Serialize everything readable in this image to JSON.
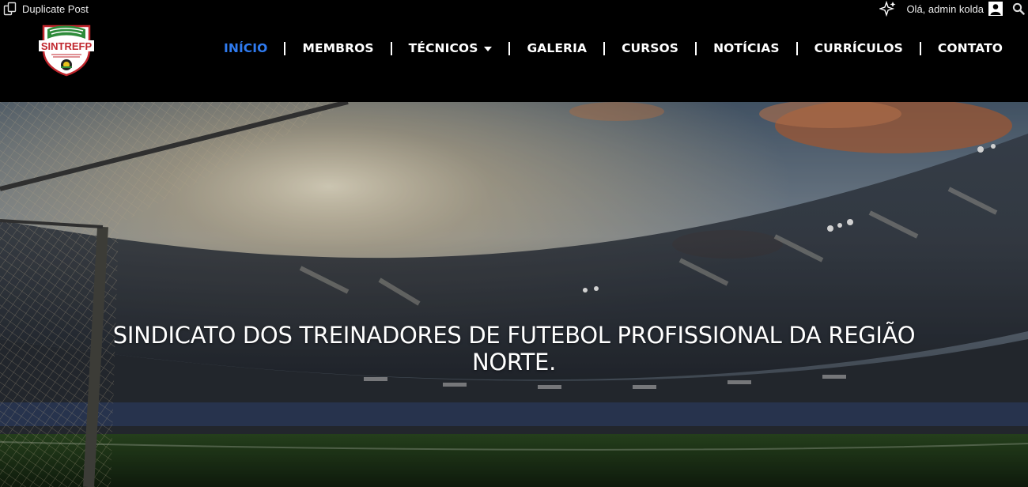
{
  "admin_bar": {
    "duplicate_post_label": "Duplicate Post",
    "greeting": "Olá, admin kolda",
    "icons": [
      "duplicate-icon",
      "sparkle-icon",
      "user-avatar-icon",
      "search-icon"
    ]
  },
  "header": {
    "logo_text": "SINTREFP",
    "nav": [
      {
        "label": "INÍCIO",
        "active": true
      },
      {
        "label": "MEMBROS"
      },
      {
        "label": "TÉCNICOS",
        "has_dropdown": true
      },
      {
        "label": "GALERIA"
      },
      {
        "label": "CURSOS"
      },
      {
        "label": "NOTÍCIAS"
      },
      {
        "label": "CURRÍCULOS"
      },
      {
        "label": "CONTATO"
      }
    ],
    "accent_color": "#2f7bf0"
  },
  "hero": {
    "title_line1": "SINDICATO DOS TREINADORES DE FUTEBOL PROFISSIONAL DA REGIÃO",
    "title_line2": "NORTE."
  }
}
